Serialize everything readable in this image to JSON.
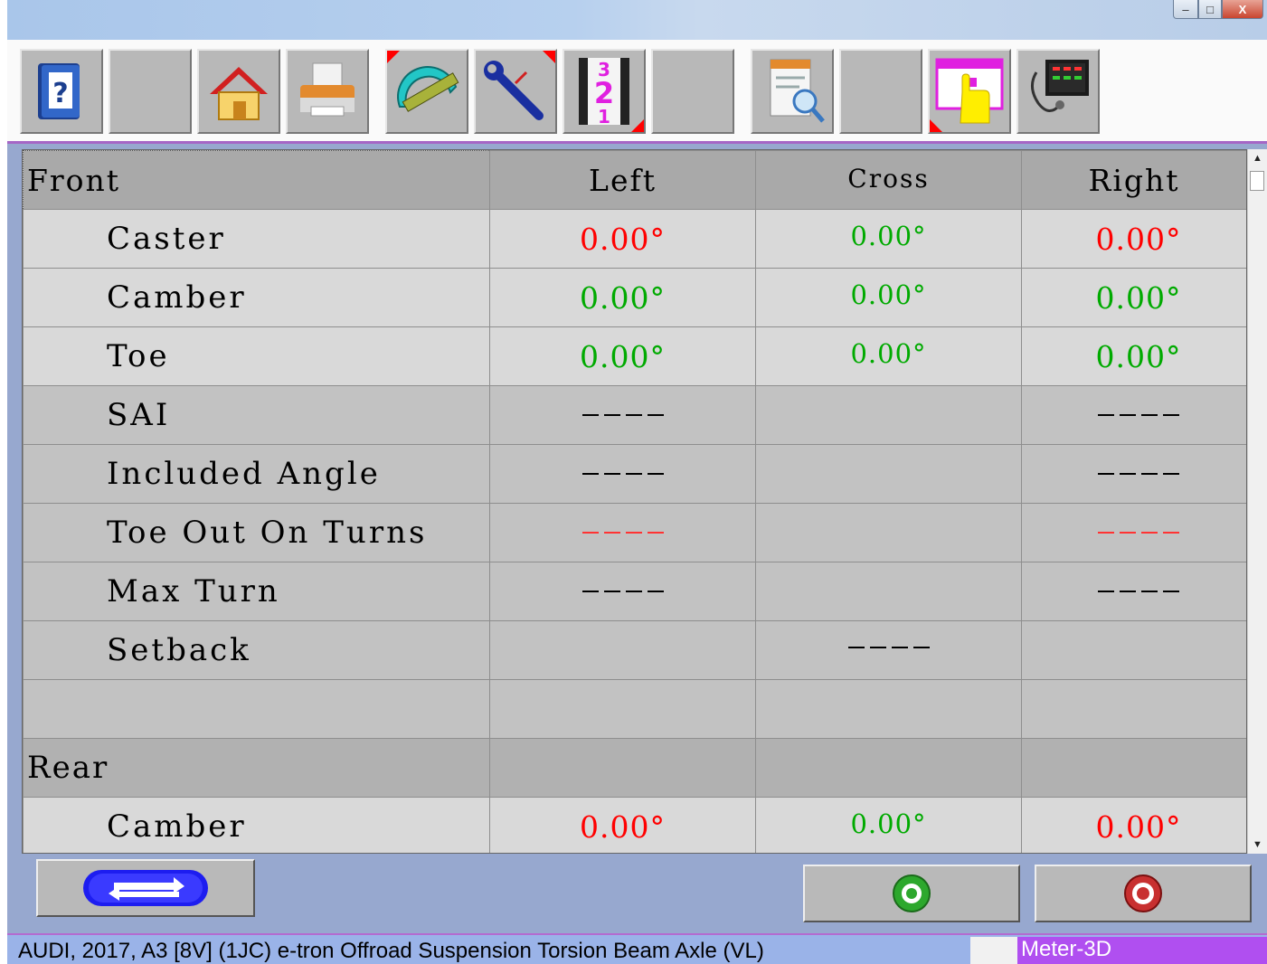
{
  "window": {
    "minimize": "–",
    "maximize": "□",
    "close": "X"
  },
  "table": {
    "header": {
      "col1": "Front",
      "col2": "Left",
      "col3": "Cross",
      "col4": "Right"
    },
    "rows": [
      {
        "label": "Caster",
        "left": "0.00°",
        "cross": "0.00°",
        "right": "0.00°"
      },
      {
        "label": "Camber",
        "left": "0.00°",
        "cross": "0.00°",
        "right": "0.00°"
      },
      {
        "label": "Toe",
        "left": "0.00°",
        "cross": "0.00°",
        "right": "0.00°"
      },
      {
        "label": "SAI"
      },
      {
        "label": "Included Angle"
      },
      {
        "label": "Toe Out On Turns"
      },
      {
        "label": "Max Turn"
      },
      {
        "label": "Setback"
      },
      {
        "label": ""
      }
    ],
    "rear_section": "Rear",
    "rear_rows": [
      {
        "label": "Camber",
        "left": "0.00°",
        "cross": "0.00°",
        "right": "0.00°"
      }
    ]
  },
  "colors": {
    "red": "#ff0000",
    "green": "#00aa00",
    "accent": "#b04ff0"
  },
  "toolbar": {
    "icons": [
      "help-book-icon",
      "blank",
      "home-icon",
      "printer-icon",
      "protractor-icon",
      "wrench-icon",
      "filmstrip-321-icon",
      "blank",
      "report-search-icon",
      "blank",
      "calendar-hand-icon",
      "stethoscope-monitor-icon"
    ]
  },
  "status": {
    "vehicle": "AUDI, 2017, A3 [8V] (1JC) e-tron Offroad Suspension Torsion Beam Axle (VL)",
    "device": "Meter-3D"
  }
}
